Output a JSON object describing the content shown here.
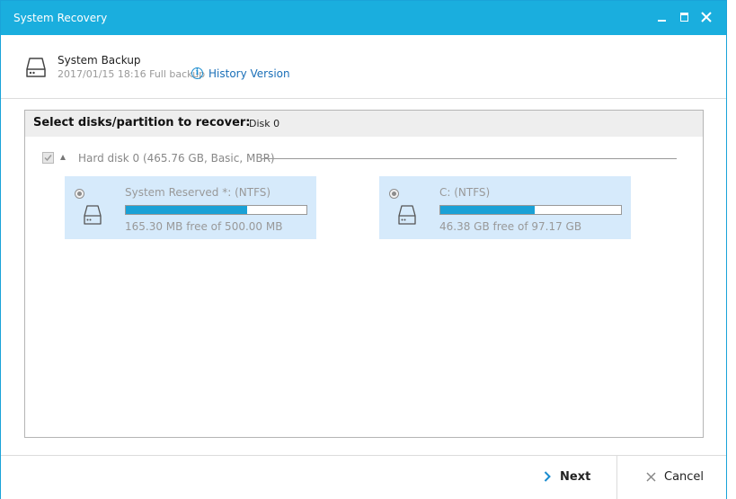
{
  "window": {
    "title": "System Recovery"
  },
  "header": {
    "backup_name": "System Backup",
    "backup_meta": "2017/01/15 18:16 Full backup",
    "history_link": "History Version",
    "info_glyph": "i"
  },
  "panel": {
    "select_label": "Select disks/partition to recover:",
    "select_value": "Disk 0",
    "disk": {
      "label": "Hard disk 0 (465.76 GB, Basic, MBR)",
      "checked": true
    },
    "partitions": [
      {
        "name": "System Reserved *: (NTFS)",
        "free_text": "165.30 MB free of 500.00 MB",
        "used_fraction": 0.67,
        "selected": true
      },
      {
        "name": "C: (NTFS)",
        "free_text": "46.38 GB free of 97.17 GB",
        "used_fraction": 0.52,
        "selected": true
      }
    ]
  },
  "footer": {
    "next_label": "Next",
    "cancel_label": "Cancel"
  },
  "colors": {
    "title_bar": "#1aaede",
    "card_bg": "#d6eafb",
    "bar_fill": "#1aa1d6",
    "link": "#1a6fb8"
  }
}
